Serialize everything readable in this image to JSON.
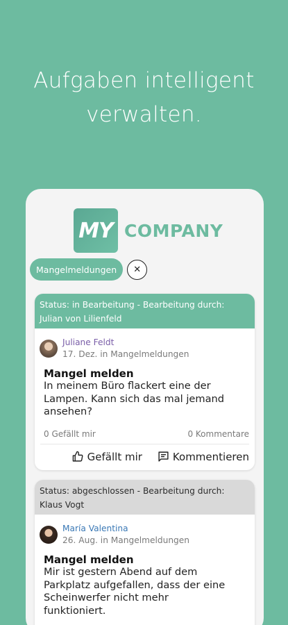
{
  "headline": {
    "line1": "Aufgaben intelligent",
    "line2": "verwalten."
  },
  "logo": {
    "badge": "MY",
    "text": "COMPANY"
  },
  "filter": {
    "chip_label": "Mangelmeldungen",
    "close_glyph": "✕"
  },
  "posts": [
    {
      "status_line1": "Status: in Bearbeitung  - Bearbeitung durch:",
      "status_line2": "Julian von Lilienfeld",
      "author": "Juliane Feldt",
      "meta": "17. Dez. in Mangelmeldungen",
      "title": "Mangel melden",
      "body_lines": [
        "In meinem Büro flackert eine der",
        "Lampen. Kann sich das mal jemand",
        "ansehen?"
      ],
      "likes": "0 Gefällt mir",
      "comments": "0 Kommentare",
      "like_action": "Gefällt mir",
      "comment_action": "Kommentieren"
    },
    {
      "status_line1": "Status: abgeschlossen  - Bearbeitung durch:",
      "status_line2": "Klaus Vogt",
      "author": "María Valentina",
      "meta": "26. Aug. in Mangelmeldungen",
      "title": "Mangel melden",
      "body_lines": [
        "Mir ist gestern Abend auf dem",
        "Parkplatz aufgefallen, dass der eine",
        "Scheinwerfer nicht mehr",
        "funktioniert."
      ]
    }
  ],
  "colors": {
    "background": "#6dbba0",
    "status_active": "#6dbba0",
    "status_done": "#d9d9d9"
  },
  "icons": [
    "thumbs-up-icon",
    "comment-icon",
    "close-icon"
  ]
}
